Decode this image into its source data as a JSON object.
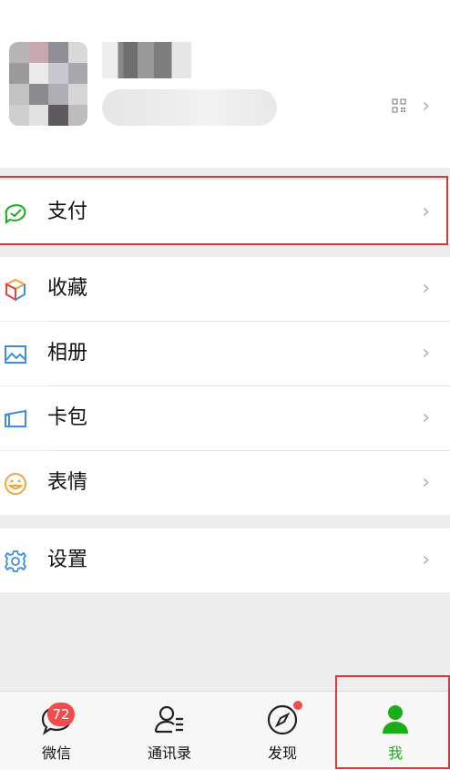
{
  "menu": {
    "items": [
      {
        "label": "支付",
        "icon": "pay-icon"
      },
      {
        "label": "收藏",
        "icon": "favorites-icon"
      },
      {
        "label": "相册",
        "icon": "album-icon"
      },
      {
        "label": "卡包",
        "icon": "card-wallet-icon"
      },
      {
        "label": "表情",
        "icon": "sticker-icon"
      },
      {
        "label": "设置",
        "icon": "settings-icon"
      }
    ]
  },
  "tabbar": {
    "tabs": [
      {
        "label": "微信",
        "badge": "72"
      },
      {
        "label": "通讯录"
      },
      {
        "label": "发现"
      },
      {
        "label": "我",
        "active": true
      }
    ]
  },
  "colors": {
    "accent_green": "#1aad19",
    "badge_red": "#f44c4c",
    "highlight_red": "#d63b3b",
    "background": "#ededed"
  }
}
